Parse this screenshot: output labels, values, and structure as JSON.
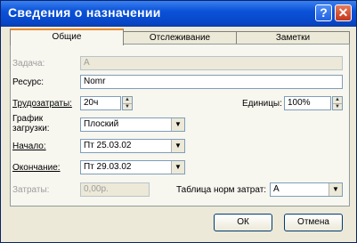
{
  "window": {
    "title": "Сведения о назначении",
    "help_label": "?",
    "close_label": "✕"
  },
  "tabs": [
    "Общие",
    "Отслеживание",
    "Заметки"
  ],
  "form": {
    "task_label": "Задача:",
    "task_value": "A",
    "resource_label": "Ресурс:",
    "resource_value": "Nomr",
    "work_label": "Трудозатраты:",
    "work_value": "20ч",
    "units_label": "Единицы:",
    "units_value": "100%",
    "contour_label_1": "График",
    "contour_label_2": "загрузки:",
    "contour_value": "Плоский",
    "start_label": "Начало:",
    "start_value": "Пт 25.03.02",
    "finish_label": "Окончание:",
    "finish_value": "Пт 29.03.02",
    "cost_label": "Затраты:",
    "cost_value": "0,00р.",
    "rate_table_label": "Таблица норм затрат:",
    "rate_table_value": "A"
  },
  "buttons": {
    "ok": "ОК",
    "cancel": "Отмена"
  }
}
